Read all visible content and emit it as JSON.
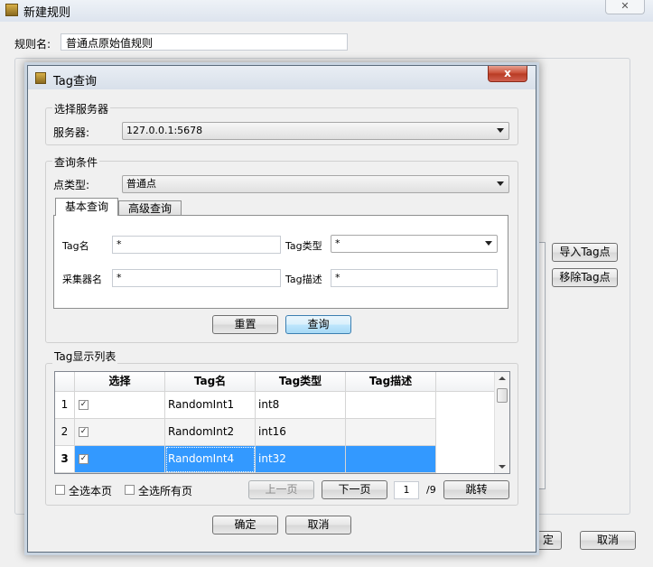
{
  "window": {
    "title": "新建规则",
    "close_glyph": "✕"
  },
  "rule": {
    "label": "规则名:",
    "value": "普通点原始值规则"
  },
  "background_buttons": {
    "import": "导入Tag点",
    "remove": "移除Tag点",
    "ok_partial": "定",
    "cancel": "取消"
  },
  "dialog": {
    "title": "Tag查询",
    "close_glyph": "x",
    "server_group": {
      "title": "选择服务器",
      "label": "服务器:",
      "value": "127.0.0.1:5678"
    },
    "query_group": {
      "title": "查询条件",
      "point_type_label": "点类型:",
      "point_type_value": "普通点",
      "tabs": [
        {
          "label": "基本查询"
        },
        {
          "label": "高级查询"
        }
      ],
      "tag_name_label": "Tag名",
      "tag_name_value": "*",
      "tag_type_label": "Tag类型",
      "tag_type_value": "*",
      "collector_label": "采集器名",
      "collector_value": "*",
      "tag_desc_label": "Tag描述",
      "tag_desc_value": "*",
      "reset_label": "重置",
      "query_label": "查询"
    },
    "list_group": {
      "title": "Tag显示列表",
      "columns": [
        "选择",
        "Tag名",
        "Tag类型",
        "Tag描述"
      ],
      "rows": [
        {
          "num": "1",
          "checked": "✓",
          "name": "RandomInt1",
          "type": "int8",
          "desc": ""
        },
        {
          "num": "2",
          "checked": "✓",
          "name": "RandomInt2",
          "type": "int16",
          "desc": ""
        },
        {
          "num": "3",
          "checked": "✓",
          "name": "RandomInt4",
          "type": "int32",
          "desc": ""
        }
      ],
      "select_page_label": "全选本页",
      "select_all_label": "全选所有页",
      "prev_label": "上一页",
      "next_label": "下一页",
      "page_value": "1",
      "page_total": "/9",
      "jump_label": "跳转"
    },
    "ok_label": "确定",
    "cancel_label": "取消"
  }
}
